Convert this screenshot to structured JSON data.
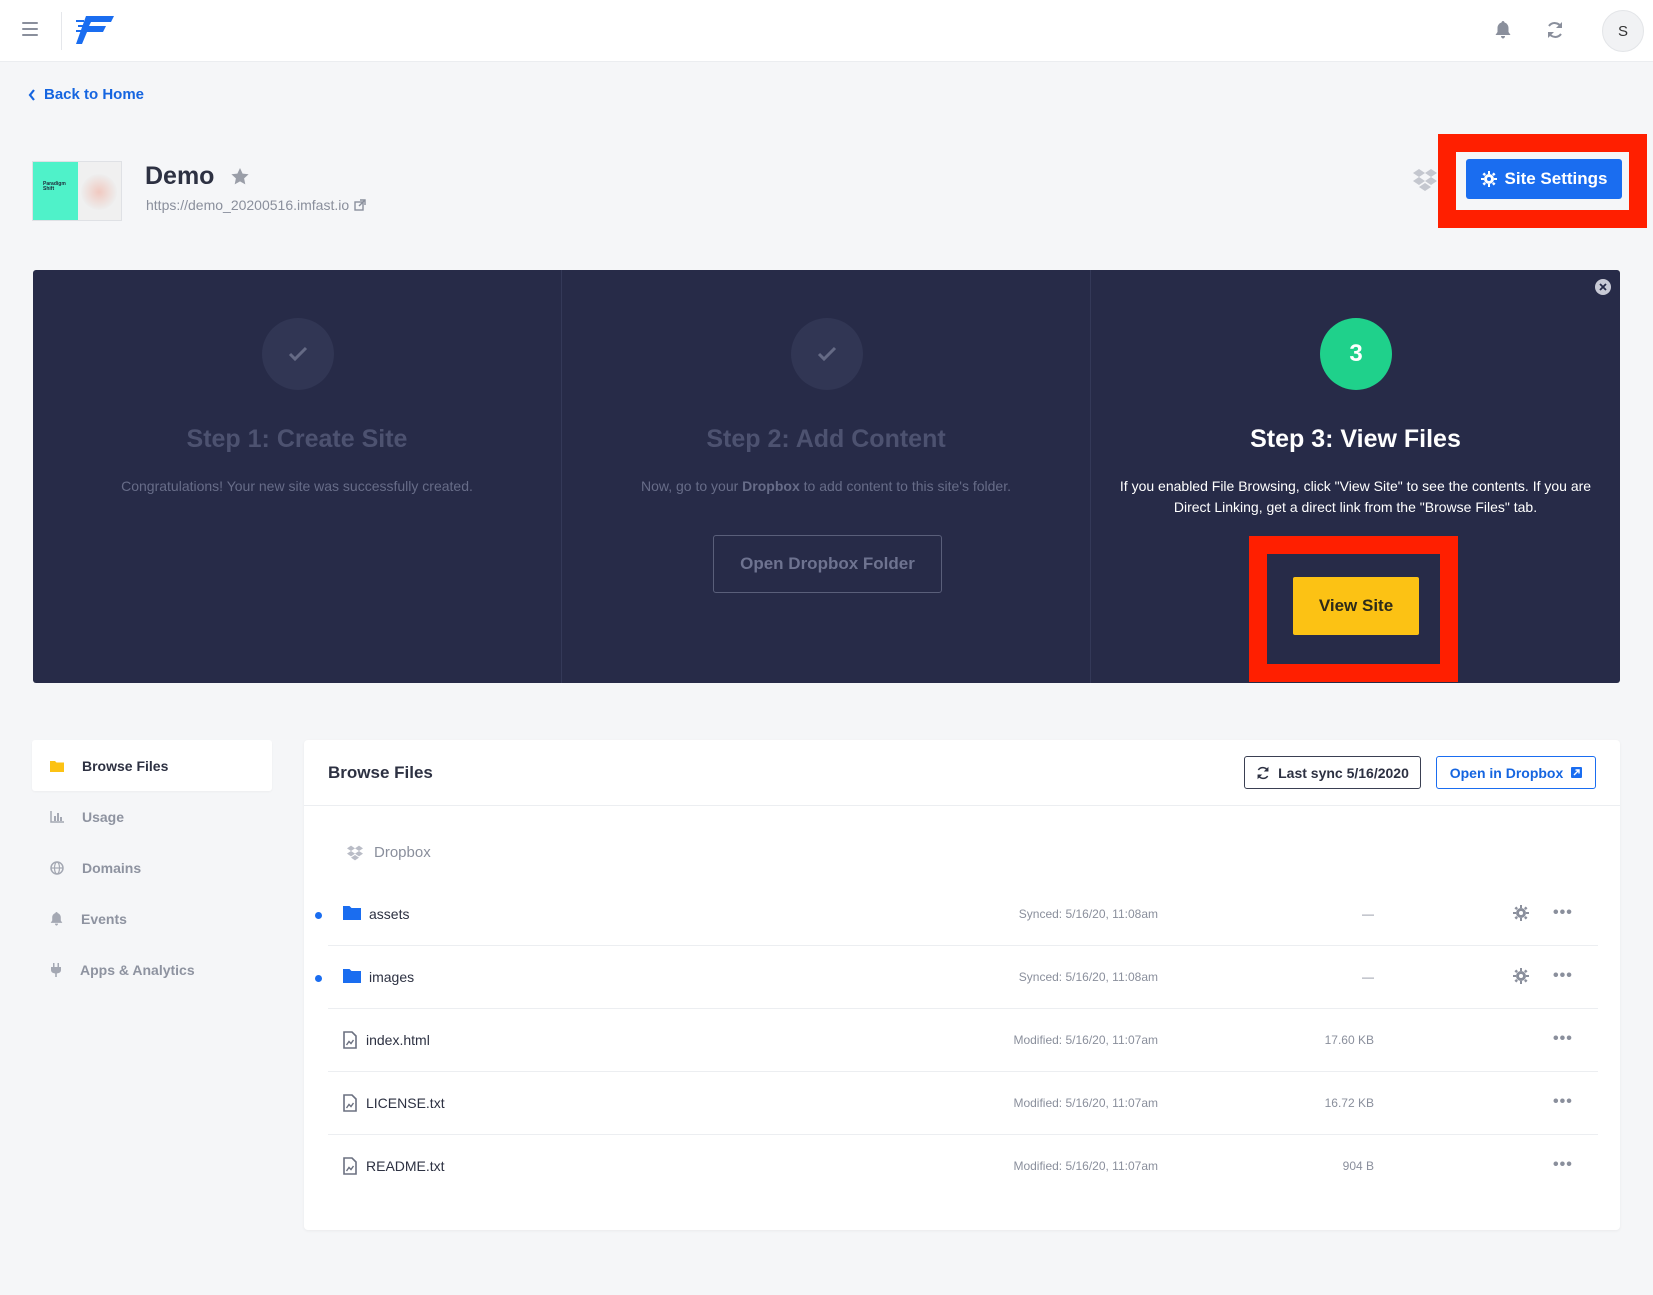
{
  "topbar": {
    "avatar_initial": "S"
  },
  "nav": {
    "back_label": "Back to Home"
  },
  "site": {
    "name": "Demo",
    "url": "https://demo_20200516.imfast.io",
    "thumbnail_text": "Paradigm Shift",
    "settings_label": "Site Settings"
  },
  "steps": [
    {
      "title": "Step 1: Create Site",
      "description": "Congratulations! Your new site was successfully created."
    },
    {
      "title": "Step 2: Add Content",
      "description_prefix": "Now, go to your ",
      "description_bold": "Dropbox",
      "description_suffix": " to add content to this site's folder.",
      "button_label": "Open Dropbox Folder"
    },
    {
      "number": "3",
      "title": "Step 3: View Files",
      "description": "If you enabled File Browsing, click \"View Site\" to see the contents. If you are Direct Linking, get a direct link from the \"Browse Files\" tab.",
      "button_label": "View Site"
    }
  ],
  "sidebar": {
    "items": [
      {
        "label": "Browse Files",
        "icon": "folder-icon"
      },
      {
        "label": "Usage",
        "icon": "chart-icon"
      },
      {
        "label": "Domains",
        "icon": "globe-icon"
      },
      {
        "label": "Events",
        "icon": "bell-icon"
      },
      {
        "label": "Apps & Analytics",
        "icon": "plug-icon"
      }
    ]
  },
  "browse": {
    "title": "Browse Files",
    "sync_label": "Last sync 5/16/2020",
    "open_dropbox_label": "Open in Dropbox",
    "breadcrumb": "Dropbox",
    "files": [
      {
        "name": "assets",
        "type": "folder",
        "status": "Synced: 5/16/20, 11:08am",
        "size": "—"
      },
      {
        "name": "images",
        "type": "folder",
        "status": "Synced: 5/16/20, 11:08am",
        "size": "—"
      },
      {
        "name": "index.html",
        "type": "file",
        "status": "Modified: 5/16/20, 11:07am",
        "size": "17.60 KB"
      },
      {
        "name": "LICENSE.txt",
        "type": "file",
        "status": "Modified: 5/16/20, 11:07am",
        "size": "16.72 KB"
      },
      {
        "name": "README.txt",
        "type": "file",
        "status": "Modified: 5/16/20, 11:07am",
        "size": "904 B"
      }
    ]
  },
  "colors": {
    "accent": "#1a6df0",
    "banner_bg": "#272b48",
    "step_active": "#1fd18b",
    "view_site_btn": "#fcc214",
    "highlight_red": "#ff1f00"
  }
}
